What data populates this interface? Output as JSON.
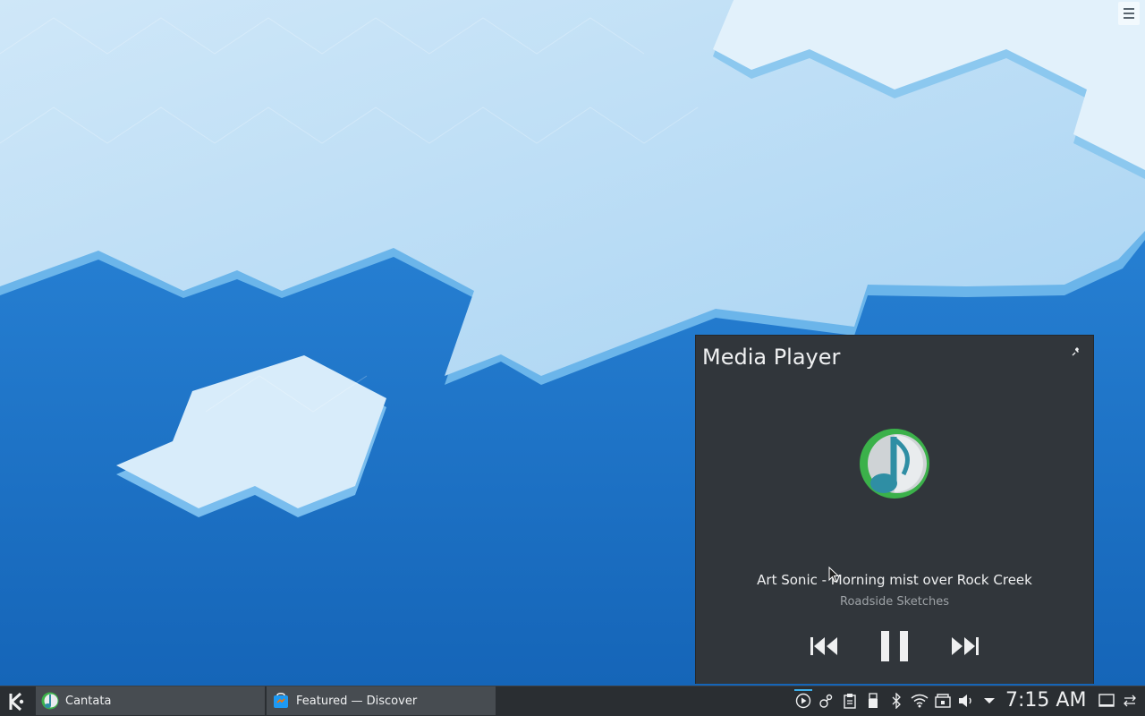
{
  "media_player": {
    "title": "Media Player",
    "track": "Art Sonic - Morning mist over Rock Creek",
    "album": "Roadside Sketches",
    "pin_icon": "pin-icon",
    "album_icon": "cantata-icon",
    "controls": {
      "previous": "skip-back-icon",
      "play_pause": "pause-icon",
      "next": "skip-forward-icon"
    }
  },
  "taskbar": {
    "launcher_icon": "kde-logo-icon",
    "tasks": [
      {
        "label": "Cantata",
        "icon": "cantata-icon"
      },
      {
        "label": "Featured — Discover",
        "icon": "discover-icon"
      }
    ],
    "tray": [
      "media-player-icon",
      "updates-icon",
      "clipboard-icon",
      "usb-device-icon",
      "bluetooth-icon",
      "wifi-icon",
      "vault-icon",
      "volume-icon",
      "expand-tray-icon"
    ],
    "clock": "7:15 AM",
    "show_desktop_icon": "show-desktop-icon",
    "panel_settings_icon": "panel-settings-icon"
  },
  "colors": {
    "accent": "#3daee9",
    "panel_bg": "#2a2e32",
    "popup_bg": "#31363b",
    "desktop_blue": "#1d79c7"
  }
}
